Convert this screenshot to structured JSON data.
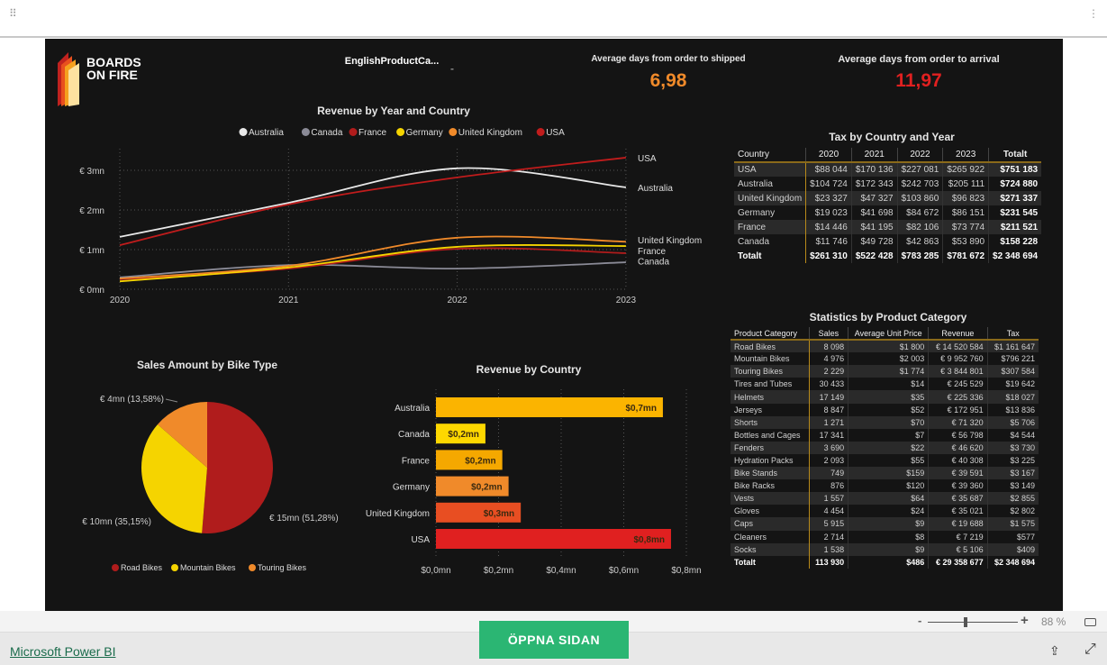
{
  "header": {
    "logo_text": "BOARDS ON FIRE",
    "slicer_title": "EnglishProductCa...",
    "slicer_value": "-",
    "kpi1": {
      "label": "Average days from order to shipped",
      "value": "6,98",
      "color": "#f08a2a"
    },
    "kpi2": {
      "label": "Average days from order to arrival",
      "value": "11,97",
      "color": "#e02020"
    }
  },
  "chart_data": [
    {
      "type": "line",
      "title": "Revenue by Year and Country",
      "x": [
        2020,
        2021,
        2022,
        2023
      ],
      "xticks": [
        "2020",
        "2021",
        "2022",
        "2023"
      ],
      "yticks": [
        "€ 0mn",
        "€ 1mn",
        "€ 2mn",
        "€ 3mn"
      ],
      "ylim": [
        0,
        3
      ],
      "legend": "top",
      "grid": true,
      "series": [
        {
          "name": "Australia",
          "color": "#e8e8e8",
          "values": [
            1.32,
            2.18,
            3.05,
            2.57
          ]
        },
        {
          "name": "Canada",
          "color": "#8a8a96",
          "values": [
            0.3,
            0.61,
            0.52,
            0.68
          ]
        },
        {
          "name": "France",
          "color": "#b01c1c",
          "values": [
            0.25,
            0.52,
            1.02,
            0.91
          ]
        },
        {
          "name": "Germany",
          "color": "#f5d400",
          "values": [
            0.2,
            0.55,
            1.07,
            1.09
          ]
        },
        {
          "name": "United Kingdom",
          "color": "#f08a2a",
          "values": [
            0.27,
            0.59,
            1.3,
            1.2
          ]
        },
        {
          "name": "USA",
          "color": "#c01c1c",
          "values": [
            1.11,
            2.14,
            2.82,
            3.32
          ]
        }
      ],
      "end_labels": [
        {
          "name": "USA",
          "y": 3.32
        },
        {
          "name": "Australia",
          "y": 2.57
        },
        {
          "name": "United Kingdom",
          "y": 1.25
        },
        {
          "name": "France",
          "y": 0.98
        },
        {
          "name": "Canada",
          "y": 0.72
        }
      ]
    },
    {
      "type": "pie",
      "title": "Sales Amount by Bike Type",
      "legend": "bottom",
      "slices": [
        {
          "name": "Road Bikes",
          "value": 51.28,
          "label": "€ 15mn (51,28%)",
          "color": "#b01c1c"
        },
        {
          "name": "Mountain Bikes",
          "value": 35.15,
          "label": "€ 10mn (35,15%)",
          "color": "#f5d400"
        },
        {
          "name": "Touring Bikes",
          "value": 13.58,
          "label": "€ 4mn (13,58%)",
          "color": "#f08a2a"
        }
      ]
    },
    {
      "type": "bar",
      "title": "Revenue by Country",
      "orientation": "horizontal",
      "xlim": [
        0,
        0.8
      ],
      "grid": true,
      "xticks": [
        "$0,0mn",
        "$0,2mn",
        "$0,4mn",
        "$0,6mn",
        "$0,8mn"
      ],
      "categories": [
        "Australia",
        "Canada",
        "France",
        "Germany",
        "United Kingdom",
        "USA"
      ],
      "values": [
        0.725,
        0.158,
        0.212,
        0.232,
        0.271,
        0.751
      ],
      "labels": [
        "$0,7mn",
        "$0,2mn",
        "$0,2mn",
        "$0,2mn",
        "$0,3mn",
        "$0,8mn"
      ],
      "colors": [
        "#fbb400",
        "#fdd800",
        "#f5a800",
        "#f08a2a",
        "#e84e22",
        "#e02020"
      ]
    }
  ],
  "tax_table": {
    "title": "Tax by Country and Year",
    "columns": [
      "Country",
      "2020",
      "2021",
      "2022",
      "2023",
      "Totalt"
    ],
    "rows": [
      [
        "USA",
        "$88 044",
        "$170 136",
        "$227 081",
        "$265 922",
        "$751 183"
      ],
      [
        "Australia",
        "$104 724",
        "$172 343",
        "$242 703",
        "$205 111",
        "$724 880"
      ],
      [
        "United Kingdom",
        "$23 327",
        "$47 327",
        "$103 860",
        "$96 823",
        "$271 337"
      ],
      [
        "Germany",
        "$19 023",
        "$41 698",
        "$84 672",
        "$86 151",
        "$231 545"
      ],
      [
        "France",
        "$14 446",
        "$41 195",
        "$82 106",
        "$73 774",
        "$211 521"
      ],
      [
        "Canada",
        "$11 746",
        "$49 728",
        "$42 863",
        "$53 890",
        "$158 228"
      ]
    ],
    "total": [
      "Totalt",
      "$261 310",
      "$522 428",
      "$783 285",
      "$781 672",
      "$2 348 694"
    ]
  },
  "stats_table": {
    "title": "Statistics by Product Category",
    "columns": [
      "Product Category",
      "Sales",
      "Average Unit Price",
      "Revenue",
      "Tax"
    ],
    "rows": [
      [
        "Road Bikes",
        "8 098",
        "$1 800",
        "€ 14 520 584",
        "$1 161 647"
      ],
      [
        "Mountain Bikes",
        "4 976",
        "$2 003",
        "€ 9 952 760",
        "$796 221"
      ],
      [
        "Touring Bikes",
        "2 229",
        "$1 774",
        "€ 3 844 801",
        "$307 584"
      ],
      [
        "Tires and Tubes",
        "30 433",
        "$14",
        "€ 245 529",
        "$19 642"
      ],
      [
        "Helmets",
        "17 149",
        "$35",
        "€ 225 336",
        "$18 027"
      ],
      [
        "Jerseys",
        "8 847",
        "$52",
        "€ 172 951",
        "$13 836"
      ],
      [
        "Shorts",
        "1 271",
        "$70",
        "€ 71 320",
        "$5 706"
      ],
      [
        "Bottles and Cages",
        "17 341",
        "$7",
        "€ 56 798",
        "$4 544"
      ],
      [
        "Fenders",
        "3 690",
        "$22",
        "€ 46 620",
        "$3 730"
      ],
      [
        "Hydration Packs",
        "2 093",
        "$55",
        "€ 40 308",
        "$3 225"
      ],
      [
        "Bike Stands",
        "749",
        "$159",
        "€ 39 591",
        "$3 167"
      ],
      [
        "Bike Racks",
        "876",
        "$120",
        "€ 39 360",
        "$3 149"
      ],
      [
        "Vests",
        "1 557",
        "$64",
        "€ 35 687",
        "$2 855"
      ],
      [
        "Gloves",
        "4 454",
        "$24",
        "€ 35 021",
        "$2 802"
      ],
      [
        "Caps",
        "5 915",
        "$9",
        "€ 19 688",
        "$1 575"
      ],
      [
        "Cleaners",
        "2 714",
        "$8",
        "€ 7 219",
        "$577"
      ],
      [
        "Socks",
        "1 538",
        "$9",
        "€ 5 106",
        "$409"
      ]
    ],
    "total": [
      "Totalt",
      "113 930",
      "$486",
      "€ 29 358 677",
      "$2 348 694"
    ]
  },
  "footer": {
    "zoom_minus": "-",
    "zoom_plus": "+",
    "zoom_level": "88 %",
    "zoom_fraction": 0.42,
    "open_button": "ÖPPNA SIDAN",
    "powerbi_link": "Microsoft Power BI"
  }
}
